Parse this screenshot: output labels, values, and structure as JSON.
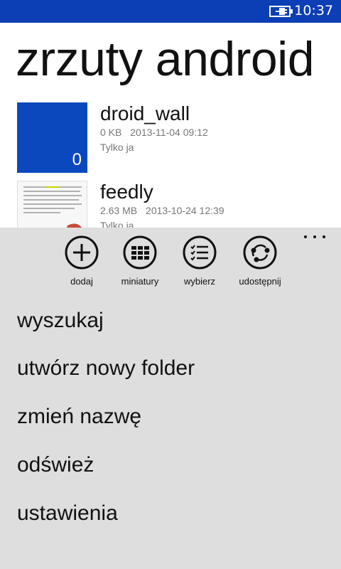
{
  "status_bar": {
    "time": "10:37",
    "battery_icon": "battery-charging-icon",
    "background": "#0c3fb5"
  },
  "page": {
    "title": "zrzuty android"
  },
  "files": [
    {
      "name": "droid_wall",
      "size": "0 KB",
      "date": "2013-11-04 09:12",
      "owner": "Tylko ja",
      "thumb_count": "0",
      "thumb_color": "#0c48bd"
    },
    {
      "name": "feedly",
      "size": "2.63 MB",
      "date": "2013-10-24 12:39",
      "owner": "Tylko ja"
    }
  ],
  "app_bar": {
    "background": "#dedede",
    "more_icon": "ellipsis-icon",
    "buttons": [
      {
        "label": "dodaj",
        "icon": "add-icon"
      },
      {
        "label": "miniatury",
        "icon": "grid-icon"
      },
      {
        "label": "wybierz",
        "icon": "select-list-icon"
      },
      {
        "label": "udostępnij",
        "icon": "share-icon"
      }
    ],
    "menu_items": [
      {
        "label": "wyszukaj"
      },
      {
        "label": "utwórz nowy folder"
      },
      {
        "label": "zmień nazwę"
      },
      {
        "label": "odśwież"
      },
      {
        "label": "ustawienia"
      }
    ]
  }
}
